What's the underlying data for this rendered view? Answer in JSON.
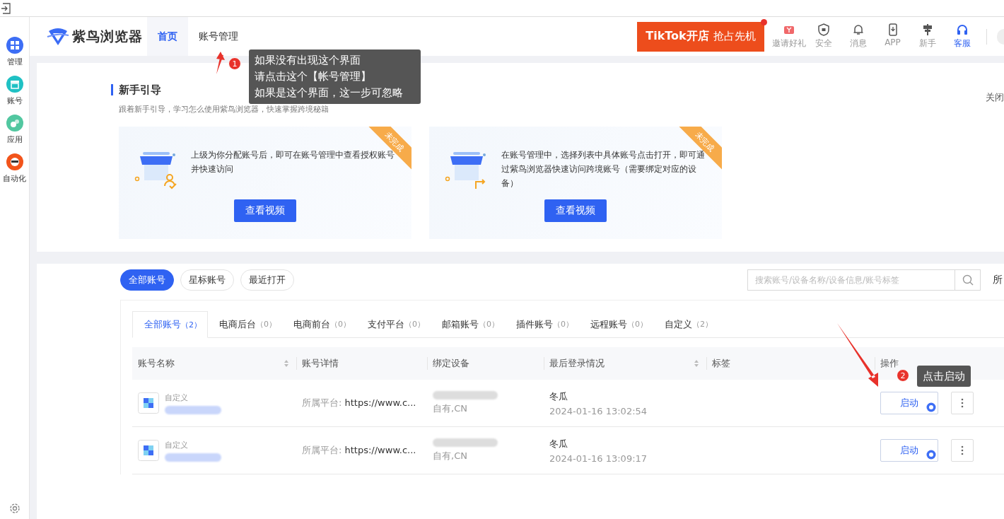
{
  "sidebar": {
    "items": [
      {
        "label": "管理",
        "color": "#3d6ef5"
      },
      {
        "label": "账号",
        "color": "#20c1c4"
      },
      {
        "label": "应用",
        "color": "#52c7a0"
      },
      {
        "label": "自动化",
        "color": "#f2541b"
      }
    ]
  },
  "header": {
    "logo": "紫鸟浏览器",
    "nav": [
      {
        "label": "首页",
        "selected": true
      },
      {
        "label": "账号管理",
        "selected": false
      }
    ],
    "banner": {
      "brand": "TikTok开店",
      "slogan": "抢占先机"
    },
    "tools": [
      {
        "label": "邀请好礼",
        "kind": "gift",
        "selected": false
      },
      {
        "label": "安全",
        "kind": "shield",
        "selected": false
      },
      {
        "label": "消息",
        "kind": "bell",
        "selected": false
      },
      {
        "label": "APP",
        "kind": "phone",
        "selected": false
      },
      {
        "label": "新手",
        "kind": "sign",
        "selected": false
      },
      {
        "label": "客服",
        "kind": "headset",
        "selected": true
      }
    ]
  },
  "guide": {
    "title": "新手引导",
    "subtitle": "跟着新手引导，学习怎么使用紫鸟浏览器，快速掌握跨境秘籍",
    "close": "关闭",
    "cards": [
      {
        "badge": "未完成",
        "text": "上级为你分配账号后，即可在账号管理中查看授权账号并快速访问",
        "button": "查看视频",
        "kind": "user"
      },
      {
        "badge": "未完成",
        "text": "在账号管理中，选择列表中具体账号点击打开，即可通过紫鸟浏览器快速访问跨境账号（需要绑定对应的设备）",
        "button": "查看视频",
        "kind": "arrow"
      }
    ]
  },
  "accounts": {
    "filters": [
      {
        "label": "全部账号",
        "selected": true
      },
      {
        "label": "星标账号",
        "selected": false
      },
      {
        "label": "最近打开",
        "selected": false
      }
    ],
    "search": {
      "placeholder": "搜索账号/设备名称/设备信息/账号标签"
    },
    "right_label": "所",
    "tabs": [
      {
        "label": "全部账号",
        "count": "（2）",
        "selected": true
      },
      {
        "label": "电商后台",
        "count": "（0）",
        "selected": false
      },
      {
        "label": "电商前台",
        "count": "（0）",
        "selected": false
      },
      {
        "label": "支付平台",
        "count": "（0）",
        "selected": false
      },
      {
        "label": "邮箱账号",
        "count": "（0）",
        "selected": false
      },
      {
        "label": "插件账号",
        "count": "（0）",
        "selected": false
      },
      {
        "label": "远程账号",
        "count": "（0）",
        "selected": false
      },
      {
        "label": "自定义",
        "count": "（2）",
        "selected": false
      }
    ],
    "columns": [
      {
        "label": "账号名称",
        "sortable": true
      },
      {
        "label": "账号详情",
        "sortable": false
      },
      {
        "label": "绑定设备",
        "sortable": false
      },
      {
        "label": "最后登录情况",
        "sortable": true
      },
      {
        "label": "标签",
        "sortable": false
      },
      {
        "label": "操作",
        "sortable": false
      }
    ],
    "rows": [
      {
        "platform": "自定义",
        "detail_label": "所属平台: ",
        "detail_url": "https://www.c...",
        "device_sub": "自有,CN",
        "login_user": "冬瓜",
        "login_time": "2024-01-16 13:02:54",
        "action": "启动"
      },
      {
        "platform": "自定义",
        "detail_label": "所属平台: ",
        "detail_url": "https://www.c...",
        "device_sub": "自有,CN",
        "login_user": "冬瓜",
        "login_time": "2024-01-16 13:09:17",
        "action": "启动"
      }
    ]
  },
  "annotations": [
    {
      "number": "1",
      "lines": [
        "如果没有出现这个界面",
        "请点击这个【帐号管理】",
        "如果是这个界面，这一步可忽略"
      ]
    },
    {
      "number": "2",
      "lines": [
        "点击启动"
      ]
    }
  ]
}
